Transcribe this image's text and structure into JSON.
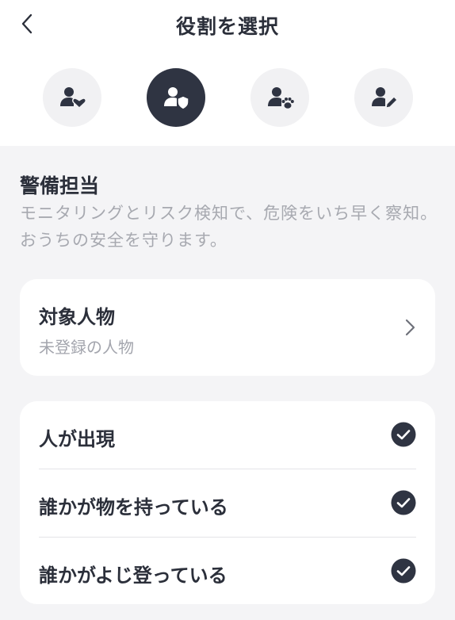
{
  "header": {
    "title": "役割を選択",
    "back_icon": "chevron-left-icon"
  },
  "roles": [
    {
      "icon": "person-heart-icon",
      "selected": false
    },
    {
      "icon": "person-shield-icon",
      "selected": true
    },
    {
      "icon": "person-paw-icon",
      "selected": false
    },
    {
      "icon": "person-pencil-icon",
      "selected": false
    }
  ],
  "role_detail": {
    "title": "警備担当",
    "description": "モニタリングとリスク検知で、危険をいち早く察知。おうちの安全を守ります。"
  },
  "target": {
    "title": "対象人物",
    "subtitle": "未登録の人物"
  },
  "events": [
    {
      "label": "人が出現",
      "checked": true
    },
    {
      "label": "誰かが物を持っている",
      "checked": true
    },
    {
      "label": "誰かがよじ登っている",
      "checked": true
    }
  ],
  "colors": {
    "accent": "#2f3442",
    "background": "#f4f4f6",
    "muted_text": "#a7a9b0"
  }
}
